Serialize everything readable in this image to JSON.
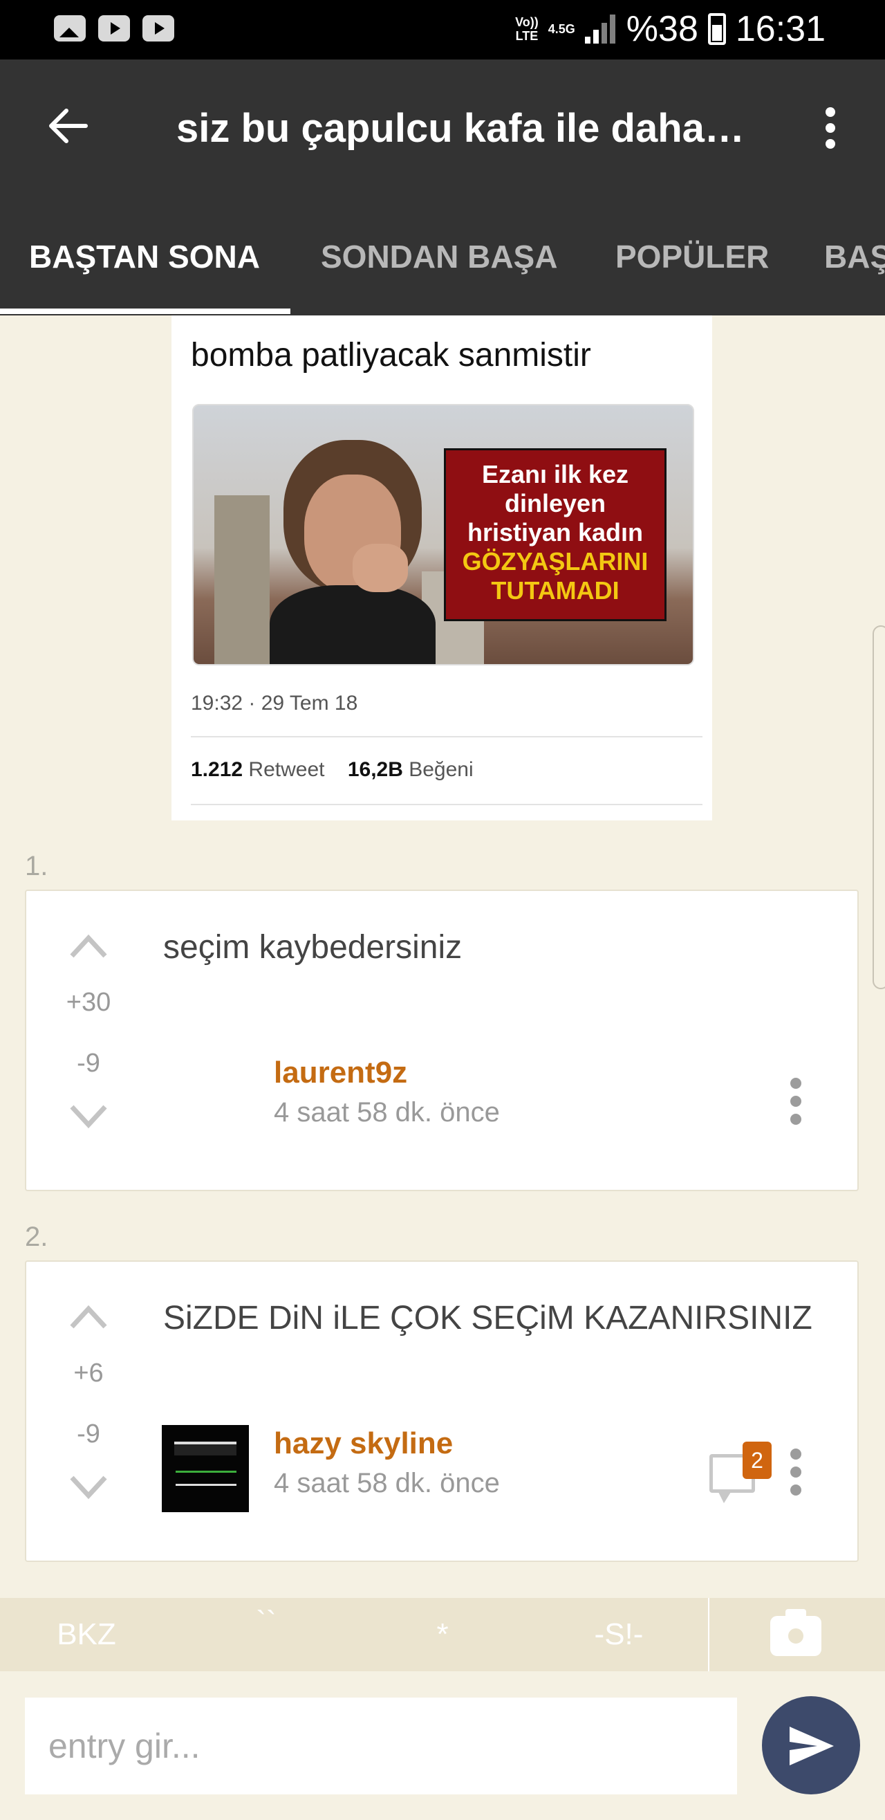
{
  "status_bar": {
    "network_top": "Vo))",
    "network_bottom": "LTE",
    "data_type": "4.5G",
    "battery": "%38",
    "time": "16:31"
  },
  "header": {
    "title": "siz bu çapulcu kafa ile daha…"
  },
  "tabs": [
    {
      "label": "BAŞTAN SONA",
      "active": true
    },
    {
      "label": "SONDAN BAŞA"
    },
    {
      "label": "POPÜLER"
    },
    {
      "label": "BAŞ"
    }
  ],
  "tweet": {
    "text": "bomba patliyacak sanmistir",
    "image_caption": {
      "line1": "Ezanı ilk kez",
      "line2": "dinleyen",
      "line3": "hristiyan kadın",
      "line4": "GÖZYAŞLARINI",
      "line5": "TUTAMADI"
    },
    "date": "19:32 · 29 Tem 18",
    "retweets": "1.212",
    "retweet_label": "Retweet",
    "likes": "16,2B",
    "likes_label": "Beğeni"
  },
  "entries": [
    {
      "number": "1.",
      "text": "seçim kaybedersiniz",
      "upvotes": "+30",
      "downvotes": "-9",
      "author": "laurent9z",
      "time": "4 saat 58 dk. önce"
    },
    {
      "number": "2.",
      "text": "SiZDE DiN iLE ÇOK SEÇiM KAZANIRSINIZ",
      "upvotes": "+6",
      "downvotes": "-9",
      "author": "hazy skyline",
      "time": "4 saat 58 dk. önce",
      "comment_count": "2"
    }
  ],
  "toolbar": {
    "bkz": "BKZ",
    "backtick": "``",
    "asterisk": "*",
    "spoiler": "-S!-"
  },
  "composer": {
    "placeholder": "entry gir..."
  },
  "colors": {
    "app_bar": "#333333",
    "background": "#f5f1e3",
    "author": "#c46b12",
    "badge": "#d0650f",
    "send_button": "#3d4a6b"
  },
  "icons": [
    "photo-icon",
    "youtube-icon",
    "back-arrow-icon",
    "more-vert-icon",
    "chevron-up-icon",
    "chevron-down-icon",
    "comment-icon",
    "camera-icon",
    "send-icon"
  ]
}
